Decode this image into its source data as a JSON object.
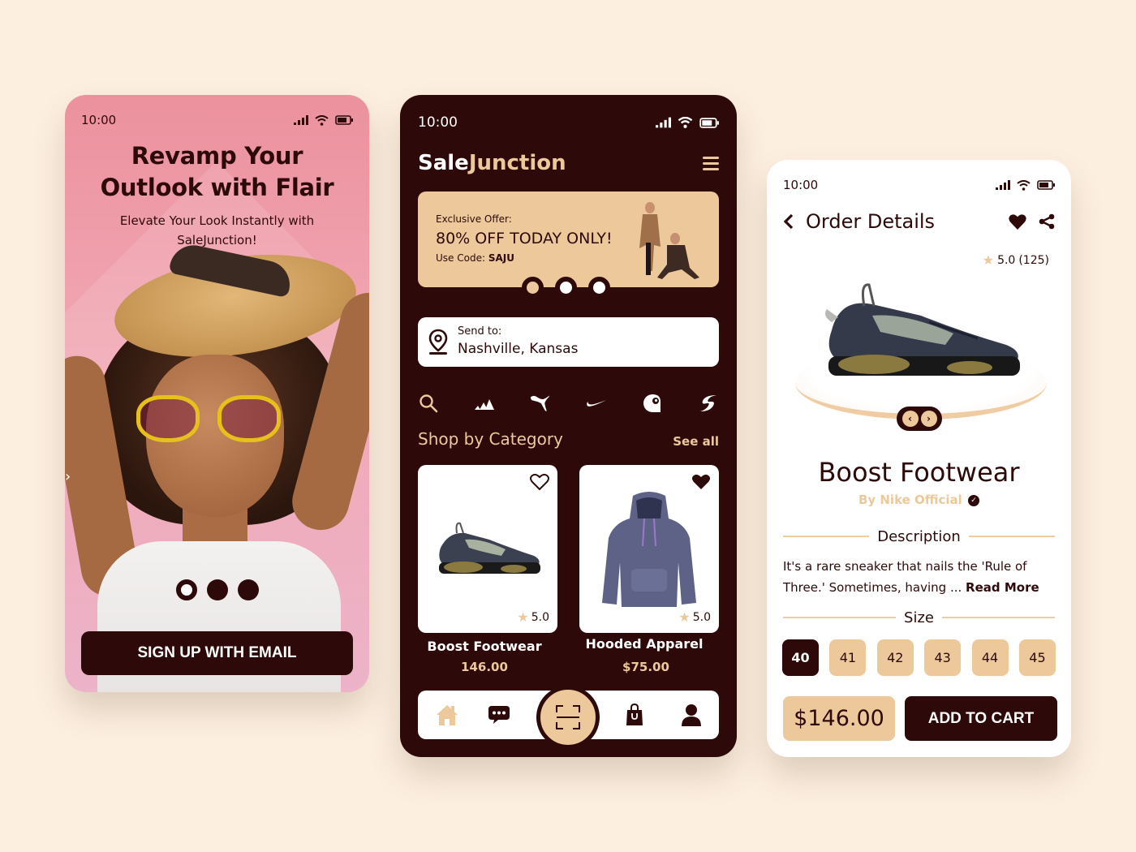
{
  "colors": {
    "background": "#fdefe0",
    "dark": "#2d0a09",
    "accent": "#ecc89b",
    "pink": "#ec919e"
  },
  "status_bar": {
    "time": "10:00",
    "icons": [
      "signal-icon",
      "wifi-icon",
      "battery-icon"
    ]
  },
  "onboarding": {
    "title_line1": "Revamp Your",
    "title_line2": "Outlook with Flair",
    "subtitle_line1": "Elevate Your Look Instantly with",
    "subtitle_line2": "SaleJunction!",
    "pagination": {
      "total": 3,
      "active": 1
    },
    "signup_button": "SIGN UP WITH EMAIL",
    "side_arrow": "›"
  },
  "home": {
    "brand_part1": "Sale",
    "brand_part2": "Junction",
    "promo": {
      "label": "Exclusive Offer:",
      "headline": "80% OFF TODAY ONLY!",
      "code_label": "Use Code:",
      "code": "SAJU",
      "pagination": {
        "total": 3,
        "active": 1
      }
    },
    "send_to": {
      "label": "Send to:",
      "value": "Nashville, Kansas"
    },
    "brand_filters": [
      "search-icon",
      "adidas-logo",
      "puma-logo",
      "nike-logo",
      "carhartt-logo",
      "brand-s-logo"
    ],
    "section_title": "Shop by Category",
    "see_all": "See all",
    "products": [
      {
        "name": "Boost Footwear",
        "price": "146.00",
        "rating": "5.0",
        "favorited": false
      },
      {
        "name": "Hooded Apparel",
        "price": "$75.00",
        "rating": "5.0",
        "favorited": true
      }
    ],
    "bottom_nav": [
      "home-icon",
      "chat-icon",
      "scan-icon",
      "shopping-bag-icon",
      "profile-icon"
    ]
  },
  "order_details": {
    "title": "Order Details",
    "rating": "5.0",
    "reviews": "(125)",
    "product_name": "Boost Footwear",
    "seller": "By Nike Official",
    "description_heading": "Description",
    "description": "It's a rare sneaker that nails the 'Rule of Three.' Sometimes, having ...",
    "read_more": "Read More",
    "size_heading": "Size",
    "sizes": [
      "40",
      "41",
      "42",
      "43",
      "44",
      "45"
    ],
    "selected_size": "40",
    "price": "$146.00",
    "add_to_cart": "ADD TO CART"
  }
}
